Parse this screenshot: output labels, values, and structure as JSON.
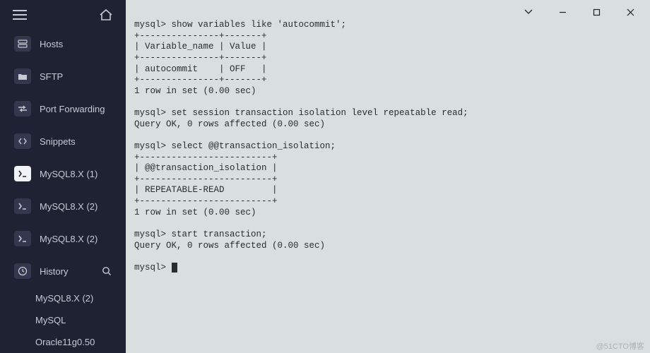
{
  "sidebar": {
    "items": [
      {
        "name": "hosts",
        "label": "Hosts"
      },
      {
        "name": "sftp",
        "label": "SFTP"
      },
      {
        "name": "port-forwarding",
        "label": "Port Forwarding"
      },
      {
        "name": "snippets",
        "label": "Snippets"
      },
      {
        "name": "mysql-1",
        "label": "MySQL8.X (1)"
      },
      {
        "name": "mysql-2a",
        "label": "MySQL8.X (2)"
      },
      {
        "name": "mysql-2b",
        "label": "MySQL8.X (2)"
      },
      {
        "name": "history",
        "label": "History"
      }
    ],
    "history_children": [
      {
        "label": "MySQL8.X (2)"
      },
      {
        "label": "MySQL"
      },
      {
        "label": "Oracle11g0.50"
      }
    ]
  },
  "terminal": {
    "prompt": "mysql>",
    "lines": [
      "mysql> show variables like 'autocommit';",
      "+---------------+-------+",
      "| Variable_name | Value |",
      "+---------------+-------+",
      "| autocommit    | OFF   |",
      "+---------------+-------+",
      "1 row in set (0.00 sec)",
      "",
      "mysql> set session transaction isolation level repeatable read;",
      "Query OK, 0 rows affected (0.00 sec)",
      "",
      "mysql> select @@transaction_isolation;",
      "+-------------------------+",
      "| @@transaction_isolation |",
      "+-------------------------+",
      "| REPEATABLE-READ         |",
      "+-------------------------+",
      "1 row in set (0.00 sec)",
      "",
      "mysql> start transaction;",
      "Query OK, 0 rows affected (0.00 sec)",
      ""
    ],
    "last_prompt": "mysql> "
  },
  "watermark": "@51CTO博客"
}
